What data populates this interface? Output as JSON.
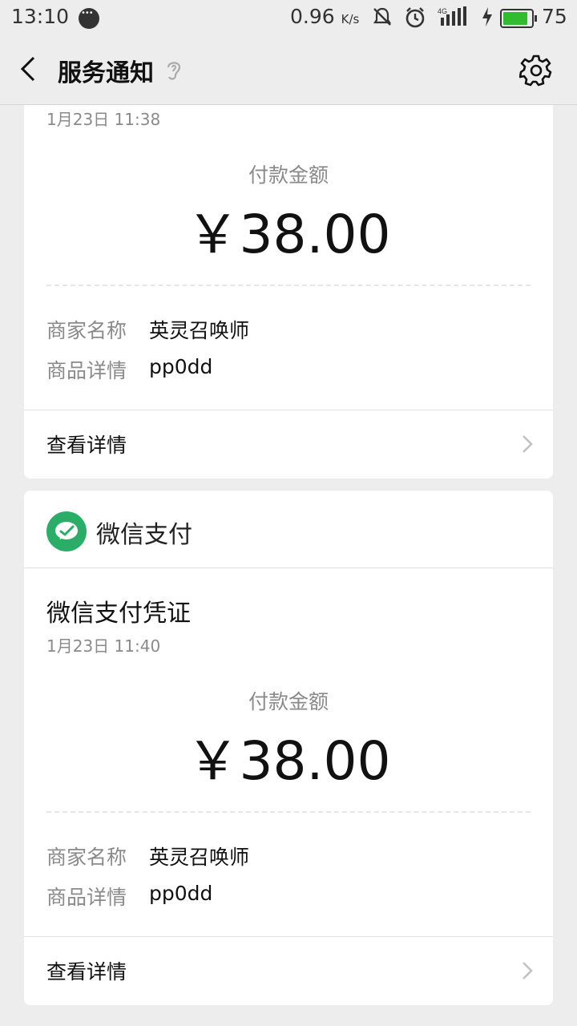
{
  "status_bar": {
    "time": "13:10",
    "net_speed": "0.96",
    "net_speed_unit": "K/s",
    "network": "4G",
    "battery_level": "75",
    "battery_color": "#2fbd2f"
  },
  "nav": {
    "title": "服务通知",
    "icons": [
      "back-icon",
      "ear-icon",
      "settings-icon"
    ]
  },
  "colors": {
    "background": "#ededed",
    "card": "#ffffff",
    "wechat_green": "#2aae67",
    "muted_text": "#8a8a8a"
  },
  "cards": [
    {
      "time": "1月23日  11:38",
      "amount_label": "付款金额",
      "amount": "￥38.00",
      "fields": [
        {
          "key": "商家名称",
          "value": "英灵召唤师"
        },
        {
          "key": "商品详情",
          "value": "pp0dd"
        }
      ],
      "detail_label": "查看详情"
    },
    {
      "header": "微信支付",
      "title": "微信支付凭证",
      "time": "1月23日  11:40",
      "amount_label": "付款金额",
      "amount": "￥38.00",
      "fields": [
        {
          "key": "商家名称",
          "value": "英灵召唤师"
        },
        {
          "key": "商品详情",
          "value": "pp0dd"
        }
      ],
      "detail_label": "查看详情"
    }
  ]
}
